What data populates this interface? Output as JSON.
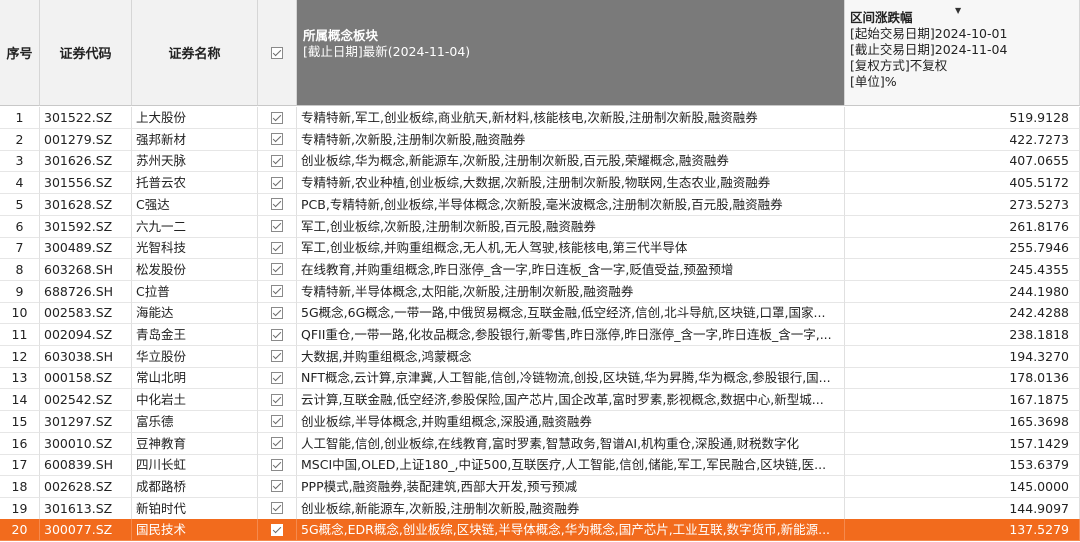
{
  "headers": {
    "idx": "序号",
    "code": "证券代码",
    "name": "证券名称",
    "concept": {
      "title": "所属概念板块",
      "sub": "[截止日期]最新(2024-11-04)"
    },
    "pct": {
      "title": "区间涨跌幅",
      "l1": "[起始交易日期]2024-10-01",
      "l2": "[截止交易日期]2024-11-04",
      "l3": "[复权方式]不复权",
      "l4": "[单位]%"
    }
  },
  "rows": [
    {
      "idx": "1",
      "code": "301522.SZ",
      "name": "上大股份",
      "concept": "专精特新,军工,创业板综,商业航天,新材料,核能核电,次新股,注册制次新股,融资融券",
      "pct": "519.9128"
    },
    {
      "idx": "2",
      "code": "001279.SZ",
      "name": "强邦新材",
      "concept": "专精特新,次新股,注册制次新股,融资融券",
      "pct": "422.7273"
    },
    {
      "idx": "3",
      "code": "301626.SZ",
      "name": "苏州天脉",
      "concept": "创业板综,华为概念,新能源车,次新股,注册制次新股,百元股,荣耀概念,融资融券",
      "pct": "407.0655"
    },
    {
      "idx": "4",
      "code": "301556.SZ",
      "name": "托普云农",
      "concept": "专精特新,农业种植,创业板综,大数据,次新股,注册制次新股,物联网,生态农业,融资融券",
      "pct": "405.5172"
    },
    {
      "idx": "5",
      "code": "301628.SZ",
      "name": "C强达",
      "concept": "PCB,专精特新,创业板综,半导体概念,次新股,毫米波概念,注册制次新股,百元股,融资融券",
      "pct": "273.5273"
    },
    {
      "idx": "6",
      "code": "301592.SZ",
      "name": "六九一二",
      "concept": "军工,创业板综,次新股,注册制次新股,百元股,融资融券",
      "pct": "261.8176"
    },
    {
      "idx": "7",
      "code": "300489.SZ",
      "name": "光智科技",
      "concept": "军工,创业板综,并购重组概念,无人机,无人驾驶,核能核电,第三代半导体",
      "pct": "255.7946"
    },
    {
      "idx": "8",
      "code": "603268.SH",
      "name": "松发股份",
      "concept": "在线教育,并购重组概念,昨日涨停_含一字,昨日连板_含一字,贬值受益,预盈预增",
      "pct": "245.4355"
    },
    {
      "idx": "9",
      "code": "688726.SH",
      "name": "C拉普",
      "concept": "专精特新,半导体概念,太阳能,次新股,注册制次新股,融资融券",
      "pct": "244.1980"
    },
    {
      "idx": "10",
      "code": "002583.SZ",
      "name": "海能达",
      "concept": "5G概念,6G概念,一带一路,中俄贸易概念,互联金融,低空经济,信创,北斗导航,区块链,口罩,国家...",
      "pct": "242.4288"
    },
    {
      "idx": "11",
      "code": "002094.SZ",
      "name": "青岛金王",
      "concept": "QFII重仓,一带一路,化妆品概念,参股银行,新零售,昨日涨停,昨日涨停_含一字,昨日连板_含一字,...",
      "pct": "238.1818"
    },
    {
      "idx": "12",
      "code": "603038.SH",
      "name": "华立股份",
      "concept": "大数据,并购重组概念,鸿蒙概念",
      "pct": "194.3270"
    },
    {
      "idx": "13",
      "code": "000158.SZ",
      "name": "常山北明",
      "concept": "NFT概念,云计算,京津冀,人工智能,信创,冷链物流,创投,区块链,华为昇腾,华为概念,参股银行,国...",
      "pct": "178.0136"
    },
    {
      "idx": "14",
      "code": "002542.SZ",
      "name": "中化岩土",
      "concept": "云计算,互联金融,低空经济,参股保险,国产芯片,国企改革,富时罗素,影视概念,数据中心,新型城...",
      "pct": "167.1875"
    },
    {
      "idx": "15",
      "code": "301297.SZ",
      "name": "富乐德",
      "concept": "创业板综,半导体概念,并购重组概念,深股通,融资融券",
      "pct": "165.3698"
    },
    {
      "idx": "16",
      "code": "300010.SZ",
      "name": "豆神教育",
      "concept": "人工智能,信创,创业板综,在线教育,富时罗素,智慧政务,智谱AI,机构重仓,深股通,财税数字化",
      "pct": "157.1429"
    },
    {
      "idx": "17",
      "code": "600839.SH",
      "name": "四川长虹",
      "concept": "MSCI中国,OLED,上证180_,中证500,互联医疗,人工智能,信创,储能,军工,军民融合,区块链,医...",
      "pct": "153.6379"
    },
    {
      "idx": "18",
      "code": "002628.SZ",
      "name": "成都路桥",
      "concept": "PPP模式,融资融券,装配建筑,西部大开发,预亏预减",
      "pct": "145.0000"
    },
    {
      "idx": "19",
      "code": "301613.SZ",
      "name": "新铂时代",
      "concept": "创业板综,新能源车,次新股,注册制次新股,融资融券",
      "pct": "144.9097"
    },
    {
      "idx": "20",
      "code": "300077.SZ",
      "name": "国民技术",
      "concept": "5G概念,EDR概念,创业板综,区块链,半导体概念,华为概念,国产芯片,工业互联,数字货币,新能源...",
      "pct": "137.5279"
    }
  ],
  "selected_row": "20"
}
